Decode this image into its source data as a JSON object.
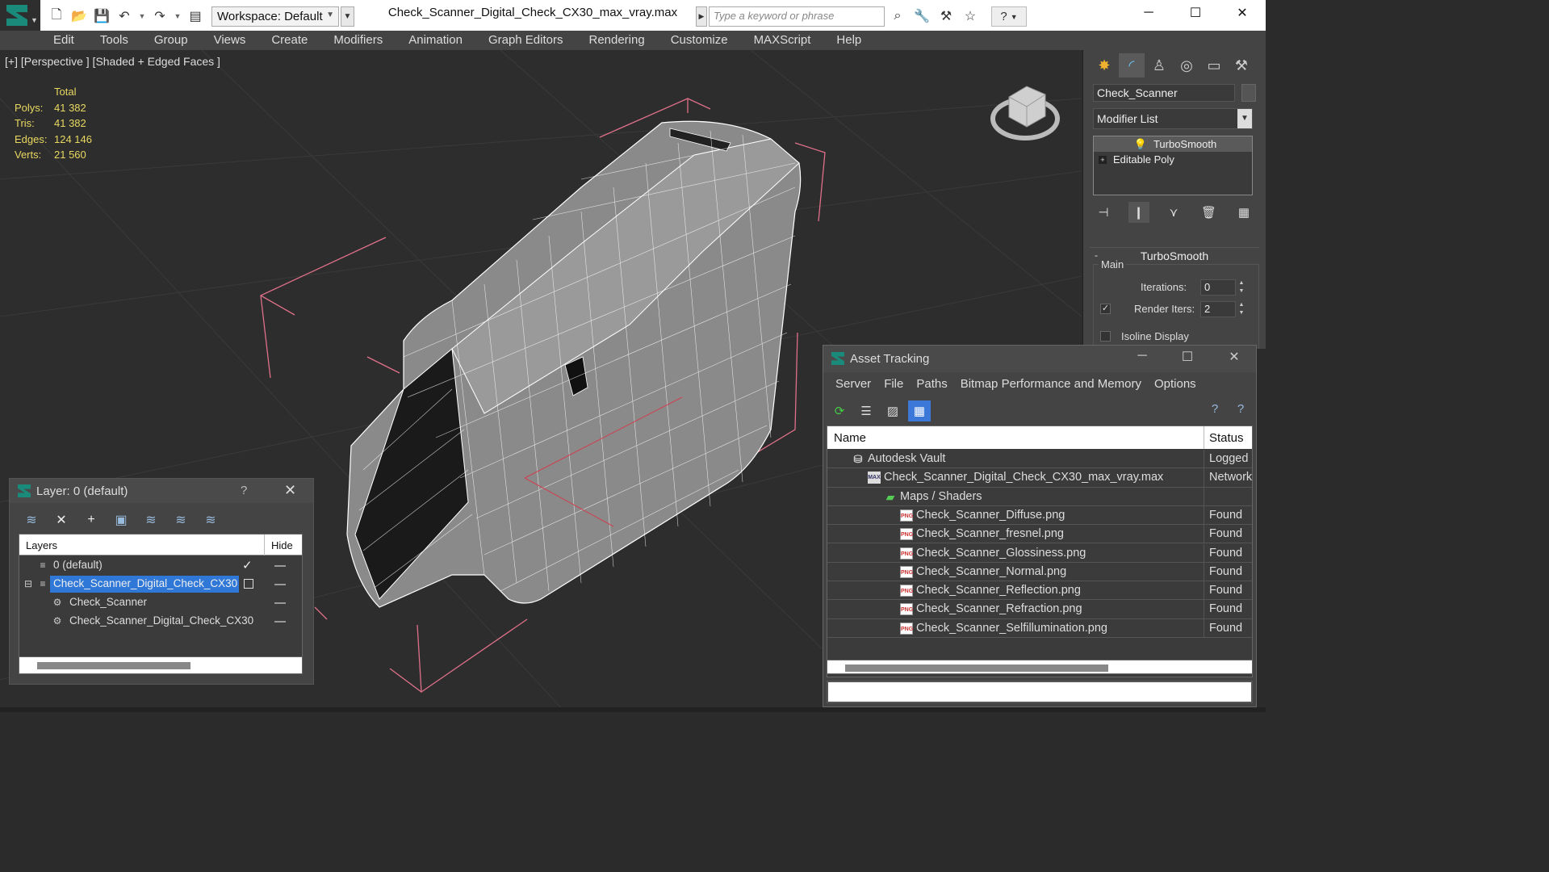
{
  "titlebar": {
    "workspace": "Workspace: Default",
    "document_title": "Check_Scanner_Digital_Check_CX30_max_vray.max",
    "search_placeholder": "Type a keyword or phrase"
  },
  "menu": [
    "Edit",
    "Tools",
    "Group",
    "Views",
    "Create",
    "Modifiers",
    "Animation",
    "Graph Editors",
    "Rendering",
    "Customize",
    "MAXScript",
    "Help"
  ],
  "viewport": {
    "label": "[+] [Perspective ] [Shaded + Edged Faces ]",
    "stats": {
      "header": "Total",
      "rows": [
        {
          "label": "Polys:",
          "value": "41 382"
        },
        {
          "label": "Tris:",
          "value": "41 382"
        },
        {
          "label": "Edges:",
          "value": "124 146"
        },
        {
          "label": "Verts:",
          "value": "21 560"
        }
      ]
    }
  },
  "command_panel": {
    "object_name": "Check_Scanner",
    "modifier_list": "Modifier List",
    "stack": [
      "TurboSmooth",
      "Editable Poly"
    ],
    "rollout_title": "TurboSmooth",
    "group_label": "Main",
    "iterations_label": "Iterations:",
    "iterations_value": "0",
    "render_iters_label": "Render Iters:",
    "render_iters_value": "2",
    "isoline_label": "Isoline Display"
  },
  "layer_window": {
    "title": "Layer: 0 (default)",
    "help": "?",
    "col_layers": "Layers",
    "col_hide": "Hide",
    "rows": [
      {
        "name": "0 (default)"
      },
      {
        "name": "Check_Scanner_Digital_Check_CX30"
      },
      {
        "name": "Check_Scanner"
      },
      {
        "name": "Check_Scanner_Digital_Check_CX30"
      }
    ]
  },
  "asset_window": {
    "title": "Asset Tracking",
    "menu": [
      "Server",
      "File",
      "Paths",
      "Bitmap Performance and Memory",
      "Options"
    ],
    "col_name": "Name",
    "col_status": "Status",
    "rows": [
      {
        "name": "Autodesk Vault",
        "status": "Logged Out"
      },
      {
        "name": "Check_Scanner_Digital_Check_CX30_max_vray.max",
        "status": "Network"
      },
      {
        "name": "Maps / Shaders",
        "status": ""
      },
      {
        "name": "Check_Scanner_Diffuse.png",
        "status": "Found"
      },
      {
        "name": "Check_Scanner_fresnel.png",
        "status": "Found"
      },
      {
        "name": "Check_Scanner_Glossiness.png",
        "status": "Found"
      },
      {
        "name": "Check_Scanner_Normal.png",
        "status": "Found"
      },
      {
        "name": "Check_Scanner_Reflection.png",
        "status": "Found"
      },
      {
        "name": "Check_Scanner_Refraction.png",
        "status": "Found"
      },
      {
        "name": "Check_Scanner_Selfillumination.png",
        "status": "Found"
      }
    ]
  },
  "colors": {
    "accent_selection": "#2f78d8",
    "stats_text": "#e8d860",
    "brand": "#1a8a7a"
  }
}
